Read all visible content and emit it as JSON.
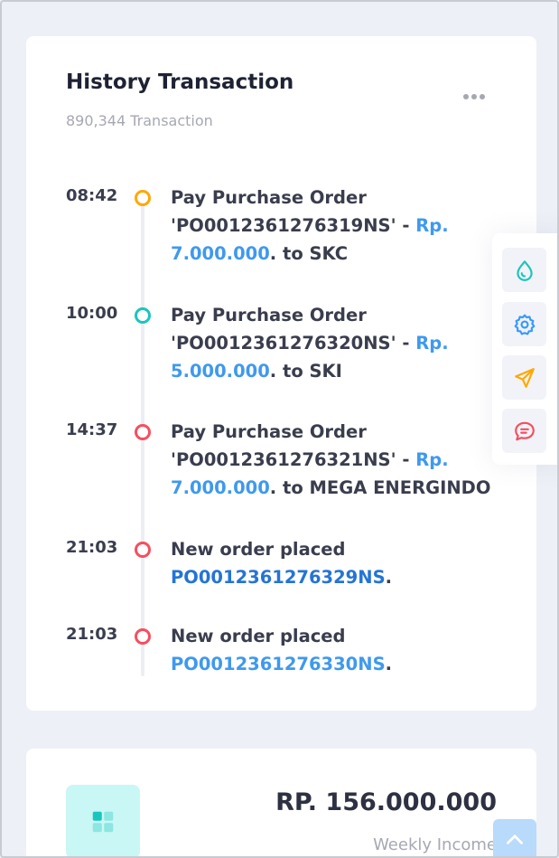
{
  "history": {
    "title": "History Transaction",
    "subtitle": "890,344 Transaction",
    "more_icon": "more-horizontal-icon",
    "items": [
      {
        "time": "08:42",
        "dot_color": "#ffa800",
        "line1": "Pay Purchase Order",
        "line2_pre": "'PO0012361276319NS' - ",
        "line2_link": "Rp.",
        "line3_link": "7.000.000",
        "line3_post": ". to SKC"
      },
      {
        "time": "10:00",
        "dot_color": "#1bc5bd",
        "line1": "Pay Purchase Order",
        "line2_pre": "'PO0012361276320NS' - ",
        "line2_link": "Rp.",
        "line3_link": "5.000.000",
        "line3_post": ". to SKI"
      },
      {
        "time": "14:37",
        "dot_color": "#f64e60",
        "line1": "Pay Purchase Order",
        "line2_pre": "'PO0012361276321NS' - ",
        "line2_link": "Rp.",
        "line3_link": "7.000.000",
        "line3_post": ". to MEGA ENERGINDO"
      },
      {
        "time": "21:03",
        "dot_color": "#f64e60",
        "line1": "New order placed",
        "link": "PO0012361276329NS",
        "post": "."
      },
      {
        "time": "21:03",
        "dot_color": "#f64e60",
        "line1": "New order placed",
        "link": "PO0012361276330NS",
        "post": "."
      }
    ]
  },
  "side_panel": {
    "buttons": [
      {
        "icon": "droplet-icon",
        "color": "#1bc5bd"
      },
      {
        "icon": "gear-icon",
        "color": "#3699ff"
      },
      {
        "icon": "send-icon",
        "color": "#ffa800"
      },
      {
        "icon": "chat-icon",
        "color": "#f64e60"
      }
    ]
  },
  "income": {
    "value": "RP. 156.000.000",
    "label": "Weekly Income",
    "icon": "grid-icon"
  },
  "scroll_top_icon": "chevron-up-icon",
  "colors": {
    "background": "#eef0f7",
    "card": "#ffffff",
    "link": "#3f99ee",
    "text": "#3a3d4d"
  }
}
